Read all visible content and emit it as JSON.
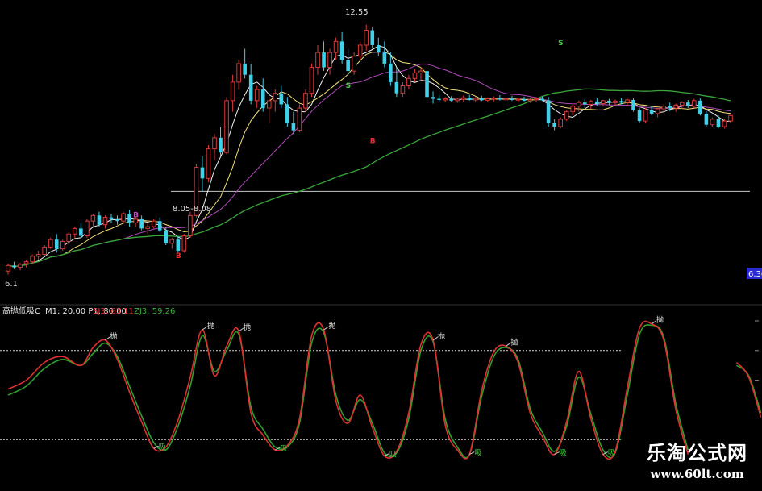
{
  "colors": {
    "up": "#d83a3a",
    "down": "#3fd0ea",
    "ma_fast": "#f2f2f2",
    "ma_mid": "#f5e27a",
    "ma_slow": "#b04ab8",
    "ma_long": "#3aa63a",
    "line_k": "#e03030",
    "line_d": "#2fa02f",
    "ref_line": "#c8c8c8",
    "accent": "#ffffff",
    "badge": "#2a2ad0"
  },
  "upper": {
    "high_label": "12.55",
    "low_label": "8.05-8.08",
    "start_label": "6.1",
    "price_badge": "6.30",
    "signals": [
      {
        "text": "S",
        "x": 56,
        "price": 10.85,
        "color": "#4ad04a"
      },
      {
        "text": "S",
        "x": 91,
        "price": 12.0,
        "color": "#4ad04a"
      },
      {
        "text": "B",
        "x": 28,
        "price": 6.25,
        "color": "#e83030"
      },
      {
        "text": "B",
        "x": 60,
        "price": 9.35,
        "color": "#e83030"
      },
      {
        "text": "B",
        "x": 21,
        "price": 7.35,
        "color": "#c050c0"
      }
    ]
  },
  "lower": {
    "indicator_name": "高抛低吸C",
    "params": "M1: 20.00  P1: 80.00",
    "val_k_label": "SJ3: 63.11",
    "val_d_label": "ZJ3: 59.26",
    "sell_glyph": "抛",
    "buy_glyph": "吸"
  },
  "watermark": {
    "cn": "乐淘公式网",
    "url": "www.60lt.com"
  },
  "chart_data": [
    {
      "type": "candlestick",
      "title": "",
      "n": 125,
      "ylim": [
        5.6,
        13.0
      ],
      "reference_lines": [
        8.05
      ],
      "ohlc": [
        [
          5.9,
          6.1,
          5.8,
          6.05
        ],
        [
          6.05,
          6.15,
          5.95,
          6.0
        ],
        [
          6.0,
          6.12,
          5.92,
          6.08
        ],
        [
          6.1,
          6.2,
          6.0,
          6.15
        ],
        [
          6.15,
          6.35,
          6.1,
          6.3
        ],
        [
          6.3,
          6.45,
          6.2,
          6.35
        ],
        [
          6.35,
          6.6,
          6.3,
          6.55
        ],
        [
          6.55,
          6.8,
          6.5,
          6.75
        ],
        [
          6.75,
          6.9,
          6.4,
          6.5
        ],
        [
          6.5,
          6.75,
          6.45,
          6.7
        ],
        [
          6.7,
          6.95,
          6.6,
          6.9
        ],
        [
          6.9,
          7.1,
          6.8,
          7.05
        ],
        [
          7.05,
          7.2,
          6.8,
          6.85
        ],
        [
          6.85,
          7.3,
          6.8,
          7.25
        ],
        [
          7.25,
          7.45,
          7.1,
          7.4
        ],
        [
          7.4,
          7.5,
          7.1,
          7.15
        ],
        [
          7.15,
          7.4,
          7.05,
          7.35
        ],
        [
          7.35,
          7.45,
          7.2,
          7.3
        ],
        [
          7.3,
          7.4,
          7.15,
          7.25
        ],
        [
          7.25,
          7.5,
          7.2,
          7.45
        ],
        [
          7.45,
          7.55,
          7.1,
          7.2
        ],
        [
          7.2,
          7.35,
          7.1,
          7.3
        ],
        [
          7.3,
          7.4,
          7.0,
          7.05
        ],
        [
          7.05,
          7.2,
          6.9,
          7.1
        ],
        [
          7.1,
          7.3,
          7.05,
          7.25
        ],
        [
          7.25,
          7.35,
          6.95,
          7.0
        ],
        [
          7.0,
          7.1,
          6.6,
          6.65
        ],
        [
          6.65,
          6.8,
          6.5,
          6.75
        ],
        [
          6.75,
          6.85,
          6.4,
          6.45
        ],
        [
          6.45,
          6.9,
          6.4,
          6.85
        ],
        [
          6.85,
          7.5,
          6.8,
          7.4
        ],
        [
          7.4,
          8.8,
          7.35,
          8.7
        ],
        [
          8.7,
          9.0,
          8.05,
          8.4
        ],
        [
          8.4,
          9.3,
          8.3,
          9.2
        ],
        [
          9.2,
          9.6,
          8.9,
          9.5
        ],
        [
          9.5,
          9.8,
          9.0,
          9.1
        ],
        [
          9.1,
          10.6,
          9.05,
          10.5
        ],
        [
          10.5,
          11.2,
          10.2,
          11.0
        ],
        [
          11.0,
          11.6,
          10.8,
          11.5
        ],
        [
          11.5,
          11.9,
          11.1,
          11.2
        ],
        [
          11.2,
          11.5,
          10.4,
          10.5
        ],
        [
          10.5,
          10.9,
          10.3,
          10.8
        ],
        [
          10.8,
          11.1,
          10.2,
          10.3
        ],
        [
          10.3,
          10.6,
          9.9,
          10.5
        ],
        [
          10.5,
          10.8,
          10.2,
          10.7
        ],
        [
          10.7,
          10.9,
          10.3,
          10.4
        ],
        [
          10.4,
          10.6,
          9.8,
          9.9
        ],
        [
          9.9,
          10.2,
          9.6,
          9.7
        ],
        [
          9.7,
          10.4,
          9.65,
          10.3
        ],
        [
          10.3,
          10.8,
          10.2,
          10.7
        ],
        [
          10.7,
          11.5,
          10.6,
          11.4
        ],
        [
          11.4,
          12.0,
          11.2,
          11.8
        ],
        [
          11.8,
          12.1,
          11.3,
          11.4
        ],
        [
          11.4,
          11.9,
          11.2,
          11.8
        ],
        [
          11.8,
          12.2,
          11.6,
          12.1
        ],
        [
          12.1,
          12.35,
          11.5,
          11.6
        ],
        [
          11.6,
          11.9,
          11.2,
          11.3
        ],
        [
          11.3,
          11.8,
          11.2,
          11.7
        ],
        [
          11.7,
          12.1,
          11.6,
          12.0
        ],
        [
          12.0,
          12.55,
          11.85,
          12.4
        ],
        [
          12.4,
          12.5,
          11.9,
          12.0
        ],
        [
          12.0,
          12.2,
          11.7,
          11.8
        ],
        [
          11.8,
          12.1,
          11.4,
          11.5
        ],
        [
          11.5,
          11.8,
          10.9,
          11.0
        ],
        [
          11.0,
          11.4,
          10.6,
          10.7
        ],
        [
          10.7,
          11.0,
          10.6,
          10.9
        ],
        [
          10.9,
          11.2,
          10.8,
          11.1
        ],
        [
          11.1,
          11.35,
          11.0,
          11.25
        ],
        [
          11.25,
          11.4,
          11.05,
          11.3
        ],
        [
          11.3,
          11.4,
          10.5,
          10.6
        ],
        [
          10.6,
          10.75,
          10.42,
          10.55
        ],
        [
          10.55,
          10.65,
          10.45,
          10.52
        ],
        [
          10.52,
          10.6,
          10.45,
          10.55
        ],
        [
          10.55,
          10.62,
          10.48,
          10.5
        ],
        [
          10.5,
          10.58,
          10.44,
          10.54
        ],
        [
          10.54,
          10.64,
          10.47,
          10.58
        ],
        [
          10.58,
          10.66,
          10.5,
          10.52
        ],
        [
          10.52,
          10.6,
          10.46,
          10.56
        ],
        [
          10.56,
          10.63,
          10.49,
          10.51
        ],
        [
          10.51,
          10.59,
          10.45,
          10.55
        ],
        [
          10.55,
          10.62,
          10.48,
          10.57
        ],
        [
          10.57,
          10.65,
          10.5,
          10.53
        ],
        [
          10.53,
          10.6,
          10.46,
          10.55
        ],
        [
          10.55,
          10.63,
          10.49,
          10.52
        ],
        [
          10.52,
          10.58,
          10.45,
          10.54
        ],
        [
          10.54,
          10.61,
          10.48,
          10.5
        ],
        [
          10.5,
          10.57,
          10.44,
          10.53
        ],
        [
          10.53,
          10.6,
          10.47,
          10.55
        ],
        [
          10.55,
          10.62,
          10.49,
          10.51
        ],
        [
          10.51,
          10.6,
          9.8,
          9.9
        ],
        [
          9.9,
          10.0,
          9.7,
          9.8
        ],
        [
          9.8,
          10.05,
          9.75,
          10.0
        ],
        [
          10.0,
          10.25,
          9.95,
          10.2
        ],
        [
          10.2,
          10.4,
          10.1,
          10.35
        ],
        [
          10.35,
          10.5,
          10.2,
          10.45
        ],
        [
          10.45,
          10.55,
          10.3,
          10.4
        ],
        [
          10.4,
          10.52,
          10.28,
          10.48
        ],
        [
          10.48,
          10.56,
          10.36,
          10.42
        ],
        [
          10.42,
          10.52,
          10.34,
          10.5
        ],
        [
          10.5,
          10.55,
          10.38,
          10.44
        ],
        [
          10.44,
          10.53,
          10.35,
          10.49
        ],
        [
          10.49,
          10.56,
          10.4,
          10.45
        ],
        [
          10.45,
          10.55,
          10.37,
          10.52
        ],
        [
          10.52,
          10.56,
          10.2,
          10.25
        ],
        [
          10.25,
          10.3,
          9.9,
          9.95
        ],
        [
          9.95,
          10.3,
          9.9,
          10.25
        ],
        [
          10.25,
          10.35,
          10.1,
          10.15
        ],
        [
          10.15,
          10.3,
          10.05,
          10.28
        ],
        [
          10.28,
          10.4,
          10.2,
          10.35
        ],
        [
          10.35,
          10.45,
          10.22,
          10.3
        ],
        [
          10.3,
          10.42,
          10.2,
          10.38
        ],
        [
          10.38,
          10.48,
          10.28,
          10.45
        ],
        [
          10.45,
          10.52,
          10.3,
          10.35
        ],
        [
          10.35,
          10.55,
          10.3,
          10.5
        ],
        [
          10.5,
          10.56,
          10.1,
          10.15
        ],
        [
          10.15,
          10.22,
          9.8,
          9.85
        ],
        [
          9.85,
          10.05,
          9.8,
          10.0
        ],
        [
          10.0,
          10.1,
          9.75,
          9.8
        ],
        [
          9.8,
          10.0,
          9.75,
          9.95
        ],
        [
          9.95,
          10.15,
          9.9,
          10.1
        ]
      ]
    },
    {
      "type": "line",
      "title": "",
      "ylim": [
        0,
        100
      ],
      "reference_lines": [
        20,
        80
      ],
      "x": [
        0,
        3,
        6,
        9,
        12,
        14,
        16,
        18,
        20,
        22,
        24,
        26,
        28,
        30,
        32,
        34,
        36,
        38,
        40,
        42,
        44,
        46,
        48,
        50,
        52,
        54,
        56,
        58,
        60,
        62,
        64,
        66,
        68,
        70,
        72,
        74,
        76,
        78,
        80,
        82,
        84,
        86,
        88,
        90,
        92,
        94,
        96,
        98,
        100,
        102,
        104,
        106,
        108,
        110,
        112,
        114,
        116,
        118,
        120,
        122,
        124
      ],
      "series": [
        {
          "name": "SJ3",
          "values": [
            54,
            60,
            72,
            76,
            70,
            82,
            87,
            74,
            52,
            32,
            14,
            15,
            33,
            62,
            94,
            63,
            83,
            93,
            38,
            23,
            13,
            16,
            34,
            90,
            94,
            46,
            31,
            50,
            28,
            9,
            12,
            38,
            84,
            87,
            30,
            13,
            10,
            53,
            79,
            83,
            72,
            38,
            22,
            10,
            32,
            66,
            34,
            10,
            12,
            55,
            95,
            98,
            87,
            40,
            10,
            null,
            null,
            null,
            72,
            62,
            35
          ]
        },
        {
          "name": "ZJ3",
          "values": [
            50,
            56,
            68,
            74,
            70,
            78,
            85,
            76,
            56,
            36,
            18,
            13,
            29,
            56,
            90,
            66,
            80,
            91,
            42,
            27,
            15,
            15,
            31,
            85,
            92,
            50,
            33,
            47,
            31,
            11,
            11,
            34,
            80,
            86,
            34,
            15,
            10,
            49,
            76,
            82,
            74,
            41,
            25,
            12,
            29,
            62,
            37,
            13,
            11,
            50,
            91,
            97,
            89,
            44,
            13,
            null,
            null,
            null,
            70,
            63,
            38
          ]
        }
      ]
    }
  ]
}
